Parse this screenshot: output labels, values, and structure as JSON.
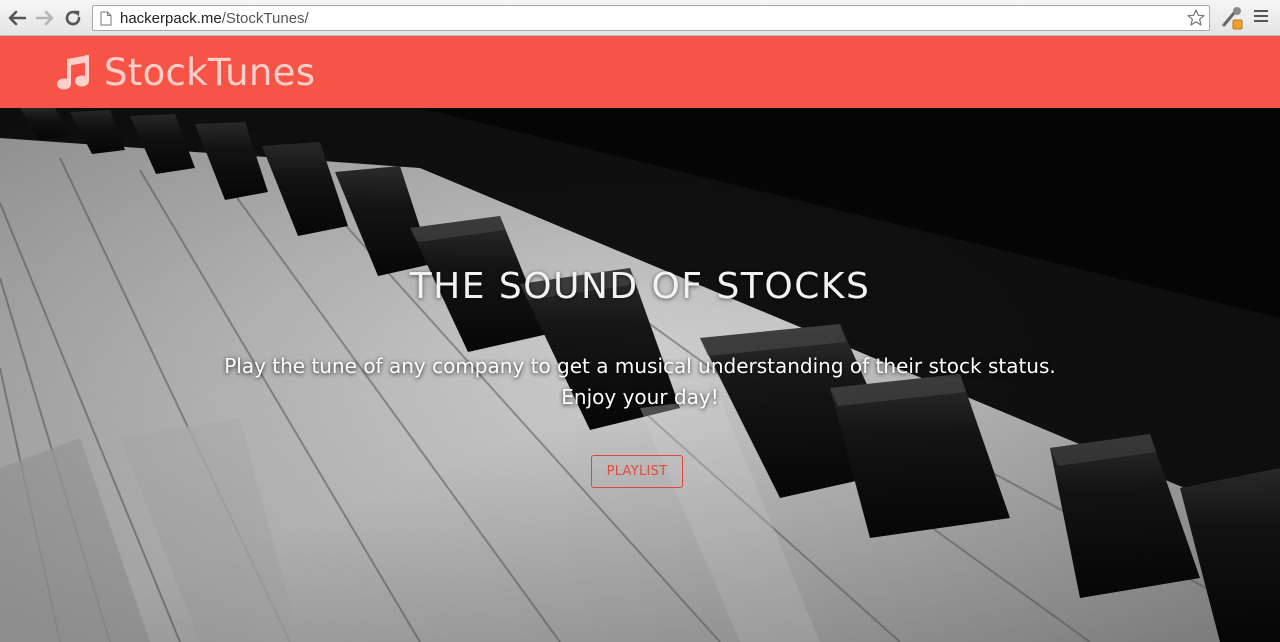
{
  "browser": {
    "url_host": "hackerpack.me",
    "url_path": "/StockTunes/"
  },
  "header": {
    "brand_name": "StockTunes",
    "brand_icon": "music-note-icon",
    "background_color": "#f55447"
  },
  "hero": {
    "title": "THE SOUND OF STOCKS",
    "subtitle_line1": "Play the tune of any company to get a musical understanding of their stock status.",
    "subtitle_line2": "Enjoy your day!",
    "button_label": "PLAYLIST",
    "accent_color": "#e54a3d"
  }
}
